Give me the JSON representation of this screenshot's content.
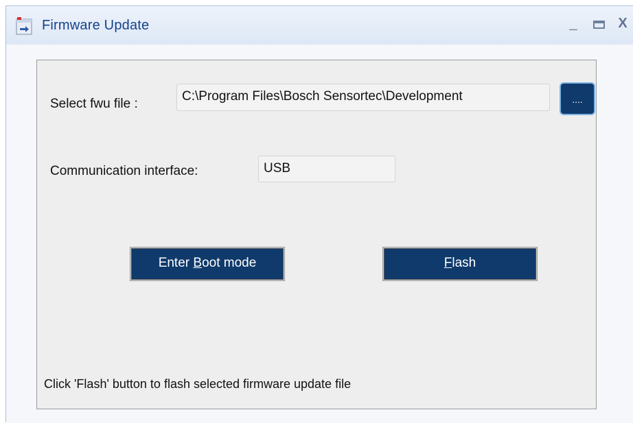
{
  "window": {
    "title": "Firmware Update",
    "controls": {
      "minimize": "_",
      "maximize": "▭",
      "close": "X"
    }
  },
  "form": {
    "file_label": "Select fwu file :",
    "file_path": "C:\\Program Files\\Bosch Sensortec\\Development",
    "browse_label": "....",
    "comm_label": "Communication interface:",
    "comm_value": "USB"
  },
  "buttons": {
    "boot": {
      "before": "Enter ",
      "mnemonic": "B",
      "after": "oot mode"
    },
    "flash": {
      "before": "",
      "mnemonic": "F",
      "after": "lash"
    }
  },
  "status_text": "Click 'Flash' button to flash selected firmware update file",
  "colors": {
    "title": "#15428b",
    "button_bg": "#0f3a6b",
    "panel_bg": "#eeeeee"
  },
  "icons": {
    "app": "firmware-app-icon",
    "minimize": "minimize-icon",
    "maximize": "maximize-icon",
    "close": "close-icon"
  }
}
